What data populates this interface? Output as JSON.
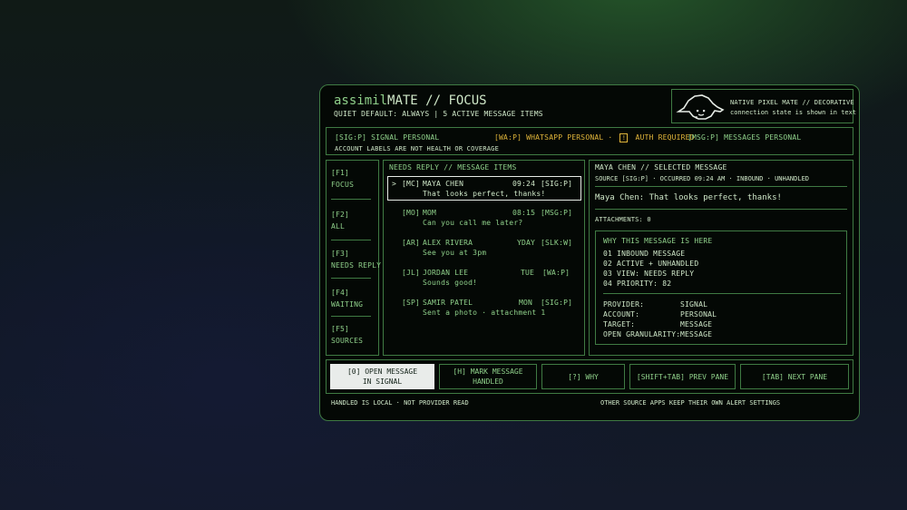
{
  "header": {
    "brand_prefix": "assimil",
    "brand_suffix": "MATE // FOCUS",
    "subtitle": "QUIET DEFAULT: ALWAYS |  5 ACTIVE MESSAGE ITEMS",
    "mascot_title": "NATIVE PIXEL MATE // DECORATIVE",
    "mascot_caption": "connection state is shown in text"
  },
  "accounts": {
    "signal": "[SIG:P] SIGNAL PERSONAL",
    "whatsapp": "[WA:P] WHATSAPP PERSONAL ·",
    "auth_icon": "!",
    "auth": "AUTH REQUIRED",
    "messages": "[MSG:P] MESSAGES PERSONAL",
    "note": "ACCOUNT LABELS ARE NOT HEALTH OR COVERAGE"
  },
  "nav": [
    {
      "key": "[F1]",
      "label": "FOCUS"
    },
    {
      "key": "[F2]",
      "label": "ALL"
    },
    {
      "key": "[F3]",
      "label": "NEEDS REPLY"
    },
    {
      "key": "[F4]",
      "label": "WAITING"
    },
    {
      "key": "[F5]",
      "label": "SOURCES"
    }
  ],
  "list": {
    "title": "NEEDS REPLY // MESSAGE ITEMS",
    "items": [
      {
        "cursor": ">",
        "initials": "[MC]",
        "name": "MAYA CHEN",
        "time": "09:24",
        "source": "[SIG:P]",
        "preview": "That looks perfect, thanks!"
      },
      {
        "cursor": "",
        "initials": "[MO]",
        "name": "MOM",
        "time": "08:15",
        "source": "[MSG:P]",
        "preview": "Can you call me later?"
      },
      {
        "cursor": "",
        "initials": "[AR]",
        "name": "ALEX RIVERA",
        "time": "YDAY",
        "source": "[SLK:W]",
        "preview": "See you at 3pm"
      },
      {
        "cursor": "",
        "initials": "[JL]",
        "name": "JORDAN LEE",
        "time": "TUE",
        "source": "[WA:P]",
        "preview": "Sounds good!"
      },
      {
        "cursor": "",
        "initials": "[SP]",
        "name": "SAMIR PATEL",
        "time": "MON",
        "source": "[SIG:P]",
        "preview": "Sent a photo · attachment 1"
      }
    ]
  },
  "detail": {
    "title": "MAYA CHEN // SELECTED MESSAGE",
    "meta": "SOURCE [SIG:P] · OCCURRED 09:24 AM · INBOUND · UNHANDLED",
    "message": "Maya Chen: That looks perfect, thanks!",
    "attachments": "ATTACHMENTS: 0",
    "why": {
      "title": "WHY THIS MESSAGE IS HERE",
      "reasons": [
        "01  INBOUND MESSAGE",
        "02  ACTIVE + UNHANDLED",
        "03  VIEW: NEEDS REPLY",
        "04  PRIORITY: 82"
      ],
      "fields": [
        {
          "k": "PROVIDER:",
          "v": "SIGNAL"
        },
        {
          "k": "ACCOUNT:",
          "v": "PERSONAL"
        },
        {
          "k": "TARGET:",
          "v": "MESSAGE"
        },
        {
          "k": "OPEN GRANULARITY:",
          "v": "MESSAGE"
        }
      ]
    }
  },
  "actions": {
    "open_line1": "[0] OPEN MESSAGE",
    "open_line2": "IN SIGNAL",
    "mark_line1": "[H] MARK MESSAGE",
    "mark_line2": "HANDLED",
    "why": "[?] WHY",
    "prev": "[SHIFT+TAB] PREV PANE",
    "next": "[TAB] NEXT PANE"
  },
  "footer": {
    "left": "HANDLED IS LOCAL · NOT PROVIDER READ",
    "right": "OTHER SOURCE APPS KEEP THEIR OWN ALERT SETTINGS"
  },
  "colors": {
    "accent": "#8fd08a",
    "warning": "#e0b53a",
    "border": "#3f7a43",
    "panel": "#040805"
  }
}
